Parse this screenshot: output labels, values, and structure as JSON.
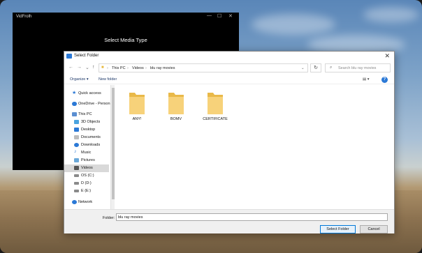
{
  "app": {
    "title": "VidFrolh",
    "heading": "Select Media Type",
    "controls": {
      "minimize": "—",
      "maximize": "☐",
      "close": "✕"
    }
  },
  "dialog": {
    "title": "Select Folder",
    "close": "✕",
    "nav": {
      "back": "←",
      "forward": "→",
      "recent": "⌄",
      "up": "↑"
    },
    "breadcrumb": [
      "This PC",
      "Videos",
      "blu ray movies"
    ],
    "breadcrumb_sep": "›",
    "address_dropdown": "⌄",
    "refresh": "↻",
    "search_placeholder": "Search blu ray movies",
    "toolbar": {
      "organize": "Organize ▾",
      "new_folder": "New folder",
      "view": "▤ ▾",
      "help": "?"
    },
    "sidebar": [
      {
        "label": "Quick access",
        "icon": "star-icon",
        "color": "#2b79d6"
      },
      {
        "label": "OneDrive - Person",
        "icon": "cloud-icon",
        "color": "#2b79d6"
      },
      {
        "label": "This PC",
        "icon": "computer-icon",
        "color": "#5b8fd1"
      },
      {
        "label": "3D Objects",
        "icon": "cube-icon",
        "color": "#4aa3df"
      },
      {
        "label": "Desktop",
        "icon": "desktop-icon",
        "color": "#2b79d6"
      },
      {
        "label": "Documents",
        "icon": "document-icon",
        "color": "#8a8a8a"
      },
      {
        "label": "Downloads",
        "icon": "download-icon",
        "color": "#2b79d6"
      },
      {
        "label": "Music",
        "icon": "music-icon",
        "color": "#2b79d6"
      },
      {
        "label": "Pictures",
        "icon": "picture-icon",
        "color": "#6aa8d8"
      },
      {
        "label": "Videos",
        "icon": "video-icon",
        "color": "#555555"
      },
      {
        "label": "OS (C:)",
        "icon": "drive-icon",
        "color": "#7a7a7a"
      },
      {
        "label": "D (D:)",
        "icon": "drive-icon",
        "color": "#7a7a7a"
      },
      {
        "label": "E (E:)",
        "icon": "drive-icon",
        "color": "#7a7a7a"
      },
      {
        "label": "Network",
        "icon": "network-icon",
        "color": "#2b79d6"
      }
    ],
    "selected_sidebar_item": "Videos",
    "folders": [
      {
        "name": "ANY!"
      },
      {
        "name": "BOMV"
      },
      {
        "name": "CERTIFICATE"
      }
    ],
    "folder_label": "Folder:",
    "folder_value": "blu ray movies",
    "select_button": "Select Folder",
    "cancel_button": "Cancel"
  }
}
